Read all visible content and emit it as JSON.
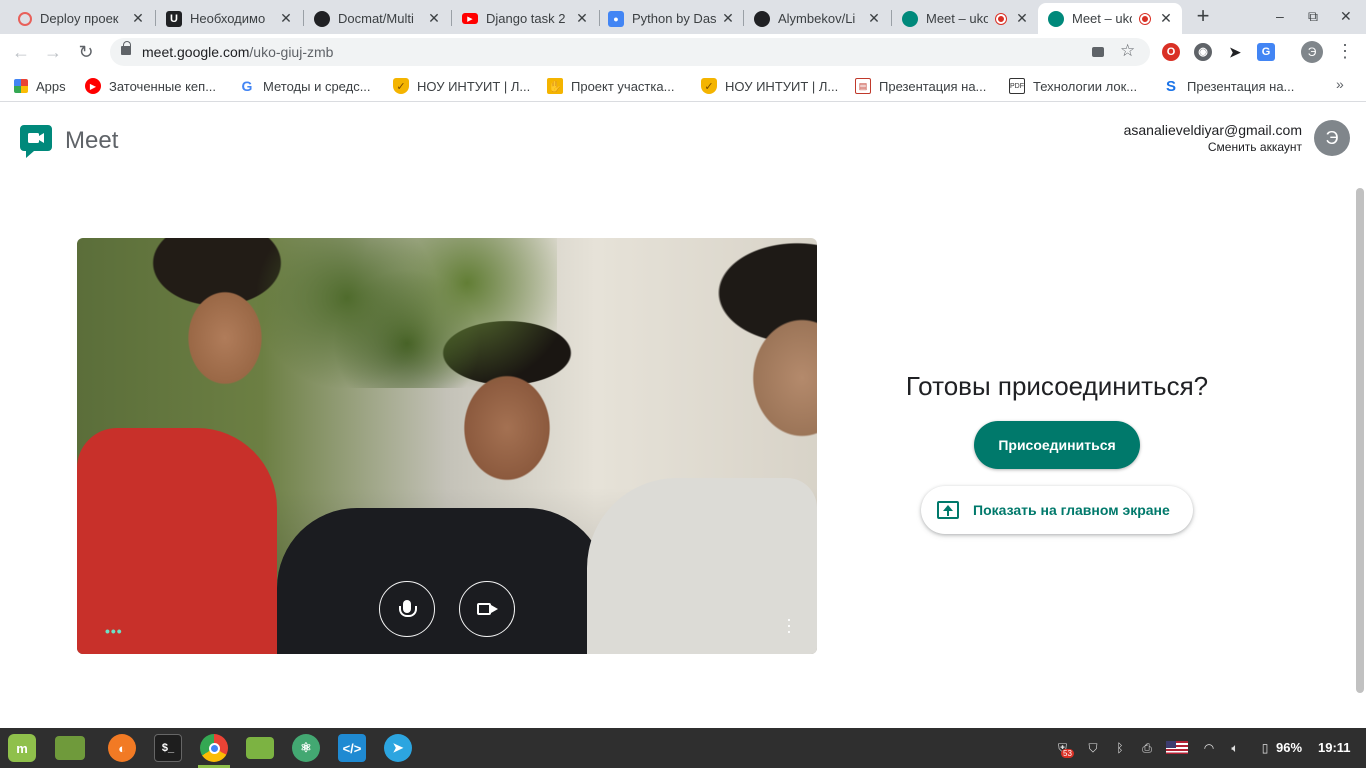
{
  "browser": {
    "tabs": [
      {
        "title": "Deploy проек",
        "favicon": "deploy-icon",
        "color": "#e8605a"
      },
      {
        "title": "Необходимо",
        "favicon": "intuit-icon",
        "color": "#202124"
      },
      {
        "title": "Docmat/Multi",
        "favicon": "github-icon",
        "color": "#202124"
      },
      {
        "title": "Django task 2",
        "favicon": "youtube-icon",
        "color": "#ff0000"
      },
      {
        "title": "Python by Das",
        "favicon": "profile-icon",
        "color": "#4285f4"
      },
      {
        "title": "Alymbekov/Li",
        "favicon": "github-icon",
        "color": "#202124"
      },
      {
        "title": "Meet – uko",
        "favicon": "meet-icon",
        "color": "#00897b",
        "recording": true
      },
      {
        "title": "Meet – uko",
        "favicon": "meet-icon",
        "color": "#00897b",
        "recording": true,
        "active": true
      }
    ],
    "close_glyph": "✕",
    "new_tab_glyph": "+",
    "window_controls": {
      "minimize": "–",
      "maximize": "⧉",
      "close": "✕"
    },
    "url_host": "meet.google.com",
    "url_path": "/uko-giuj-zmb",
    "profile_initial": "Э",
    "bookmarks": [
      {
        "label": "Apps",
        "icon": "apps-grid-icon",
        "color": "#ea4335"
      },
      {
        "label": "Заточенные кеп...",
        "icon": "youtube-icon",
        "color": "#ff0000"
      },
      {
        "label": "Методы и средс...",
        "icon": "google-icon",
        "color": "#4285f4"
      },
      {
        "label": "НОУ ИНТУИТ | Л...",
        "icon": "intuit-shield-icon",
        "color": "#f4b400"
      },
      {
        "label": "Проект участка...",
        "icon": "hand-icon",
        "color": "#f4b400"
      },
      {
        "label": "НОУ ИНТУИТ | Л...",
        "icon": "intuit-shield-icon",
        "color": "#f4b400"
      },
      {
        "label": "Презентация на...",
        "icon": "presentation-icon",
        "color": "#c0392b"
      },
      {
        "label": "Технологии лок...",
        "icon": "pdf-icon",
        "color": "#333333"
      },
      {
        "label": "Презентация на...",
        "icon": "slideshare-icon",
        "color": "#1a73e8"
      }
    ]
  },
  "meet": {
    "brand": "Meet",
    "account_email": "asanalieveldiyar@gmail.com",
    "switch_account": "Сменить аккаунт",
    "avatar_initial": "Э",
    "ready_heading": "Готовы присоединиться?",
    "join_label": "Присоединиться",
    "present_label": "Показать на главном экране",
    "accent": "#00796b"
  },
  "taskbar": {
    "apps": [
      {
        "name": "mint-menu-icon",
        "color": "#8fc04b"
      },
      {
        "name": "show-desktop-icon",
        "color": "#6f9a3b"
      },
      {
        "name": "firefox-icon",
        "color": "#f27a24"
      },
      {
        "name": "terminal-icon",
        "color": "#1e1e1e"
      },
      {
        "name": "chrome-icon",
        "color": "#4285f4"
      },
      {
        "name": "files-icon",
        "color": "#7cb342"
      },
      {
        "name": "atom-icon",
        "color": "#43a872"
      },
      {
        "name": "vscode-icon",
        "color": "#1f8ad2"
      },
      {
        "name": "telegram-icon",
        "color": "#2ca5e0"
      }
    ],
    "battery": "96%",
    "clock": "19:11",
    "notification_badge": "53"
  }
}
